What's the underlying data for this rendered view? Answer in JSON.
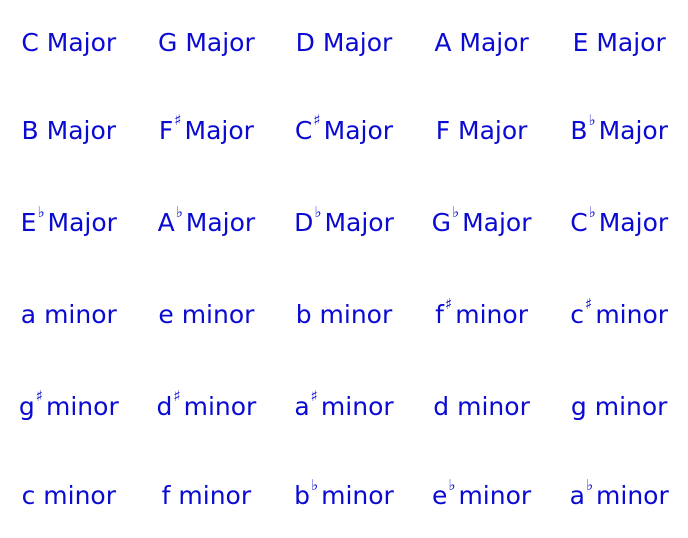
{
  "keys": [
    {
      "root": "C",
      "accidental": "",
      "quality": "Major"
    },
    {
      "root": "G",
      "accidental": "",
      "quality": "Major"
    },
    {
      "root": "D",
      "accidental": "",
      "quality": "Major"
    },
    {
      "root": "A",
      "accidental": "",
      "quality": "Major"
    },
    {
      "root": "E",
      "accidental": "",
      "quality": "Major"
    },
    {
      "root": "B",
      "accidental": "",
      "quality": "Major"
    },
    {
      "root": "F",
      "accidental": "♯",
      "quality": "Major"
    },
    {
      "root": "C",
      "accidental": "♯",
      "quality": "Major"
    },
    {
      "root": "F",
      "accidental": "",
      "quality": "Major"
    },
    {
      "root": "B",
      "accidental": "♭",
      "quality": "Major"
    },
    {
      "root": "E",
      "accidental": "♭",
      "quality": "Major"
    },
    {
      "root": "A",
      "accidental": "♭",
      "quality": "Major"
    },
    {
      "root": "D",
      "accidental": "♭",
      "quality": "Major"
    },
    {
      "root": "G",
      "accidental": "♭",
      "quality": "Major"
    },
    {
      "root": "C",
      "accidental": "♭",
      "quality": "Major"
    },
    {
      "root": "a",
      "accidental": "",
      "quality": "minor"
    },
    {
      "root": "e",
      "accidental": "",
      "quality": "minor"
    },
    {
      "root": "b",
      "accidental": "",
      "quality": "minor"
    },
    {
      "root": "f",
      "accidental": "♯",
      "quality": "minor"
    },
    {
      "root": "c",
      "accidental": "♯",
      "quality": "minor"
    },
    {
      "root": "g",
      "accidental": "♯",
      "quality": "minor"
    },
    {
      "root": "d",
      "accidental": "♯",
      "quality": "minor"
    },
    {
      "root": "a",
      "accidental": "♯",
      "quality": "minor"
    },
    {
      "root": "d",
      "accidental": "",
      "quality": "minor"
    },
    {
      "root": "g",
      "accidental": "",
      "quality": "minor"
    },
    {
      "root": "c",
      "accidental": "",
      "quality": "minor"
    },
    {
      "root": "f",
      "accidental": "",
      "quality": "minor"
    },
    {
      "root": "b",
      "accidental": "♭",
      "quality": "minor"
    },
    {
      "root": "e",
      "accidental": "♭",
      "quality": "minor"
    },
    {
      "root": "a",
      "accidental": "♭",
      "quality": "minor"
    }
  ],
  "colors": {
    "text": "#0a0ad2",
    "background": "#ffffff"
  }
}
